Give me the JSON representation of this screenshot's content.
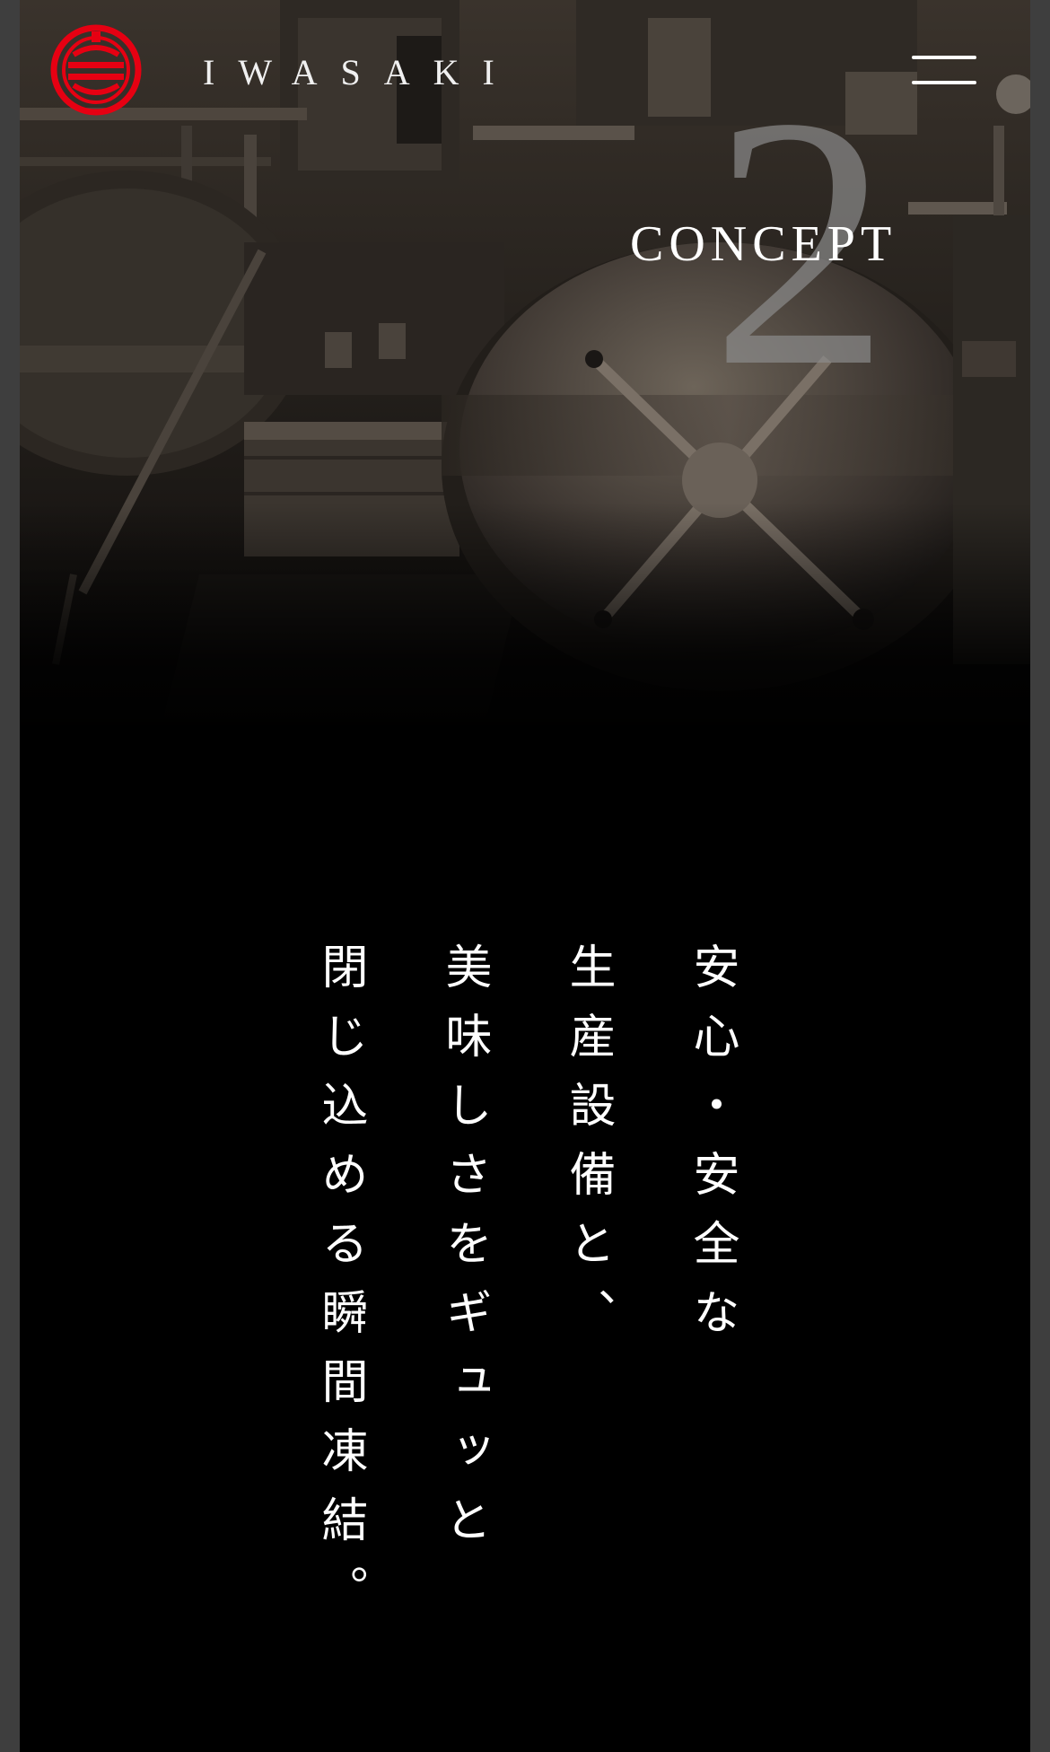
{
  "header": {
    "brand": "IWASAKI",
    "logo_icon": "iwasaki-crest-icon",
    "menu_icon": "hamburger-menu-icon"
  },
  "hero": {
    "section_number": "2",
    "section_title": "CONCEPT"
  },
  "copy": {
    "lines": [
      "安心・安全な",
      "生産設備と、",
      "美味しさをギュッと",
      "閉じ込める瞬間凍結。"
    ]
  },
  "colors": {
    "logo_red": "#e60012",
    "background": "#000000",
    "side_bars": "#3e3e3e",
    "text": "#ffffff",
    "number_gray": "#8c8c8c"
  }
}
